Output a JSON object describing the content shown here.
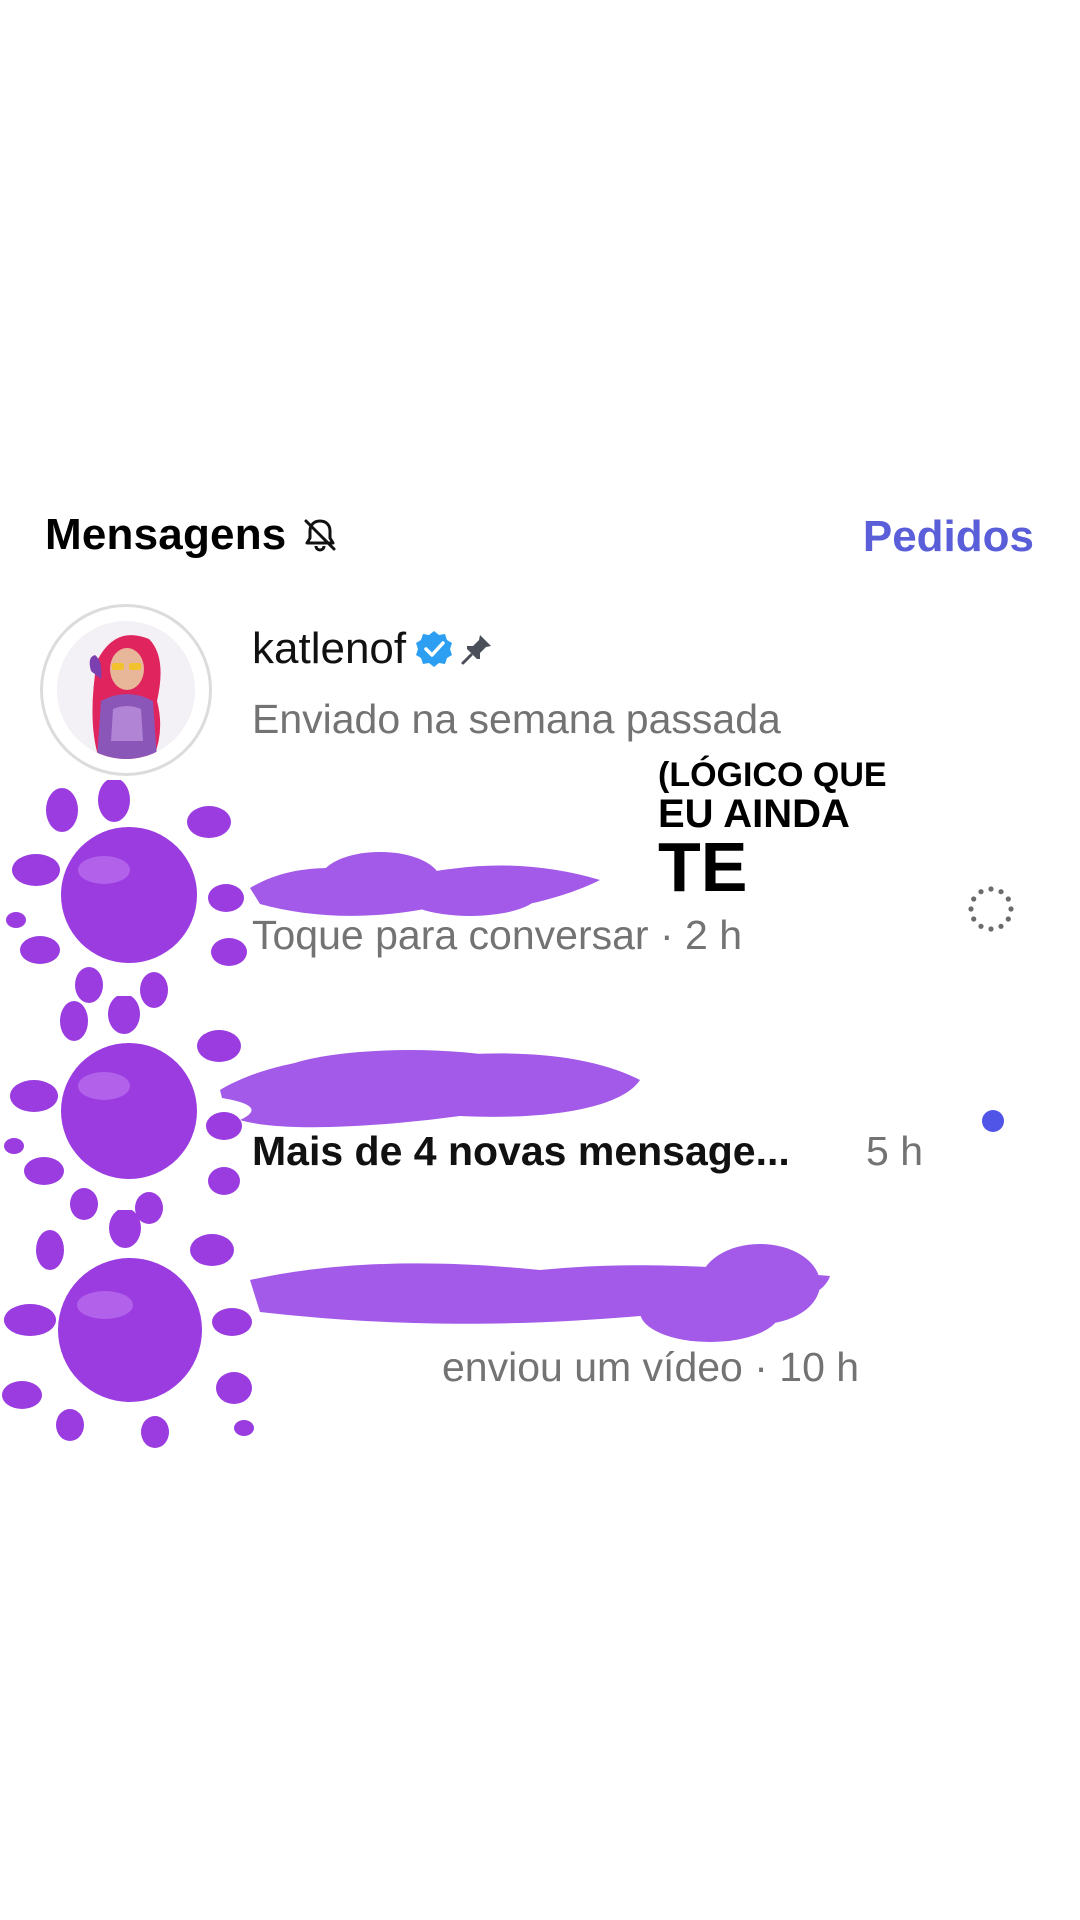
{
  "header": {
    "title": "Mensagens",
    "requests_label": "Pedidos"
  },
  "threads": [
    {
      "name": "katlenof",
      "subtitle": "Enviado na semana passada",
      "verified": true,
      "pinned": true
    },
    {
      "subtitle": "Toque para conversar · 2 h",
      "status_icon": "loading-spinner-icon"
    },
    {
      "subtitle": "Mais de 4 novas mensage...",
      "time": "5 h",
      "unread": true
    },
    {
      "subtitle": "enviou um vídeo · 10 h"
    }
  ],
  "overlay_text": {
    "line1": "(LÓGICO QUE",
    "line2": "EU AINDA",
    "line3": "TE"
  },
  "colors": {
    "accent": "#5a5ed8",
    "unread_dot": "#5055e8",
    "verified_badge": "#2c9ff3",
    "scribble": "#a35ae8",
    "splat": "#9b3ce0"
  },
  "icons": [
    "bell-off-icon",
    "verified-badge-icon",
    "pin-icon",
    "loading-spinner-icon"
  ]
}
